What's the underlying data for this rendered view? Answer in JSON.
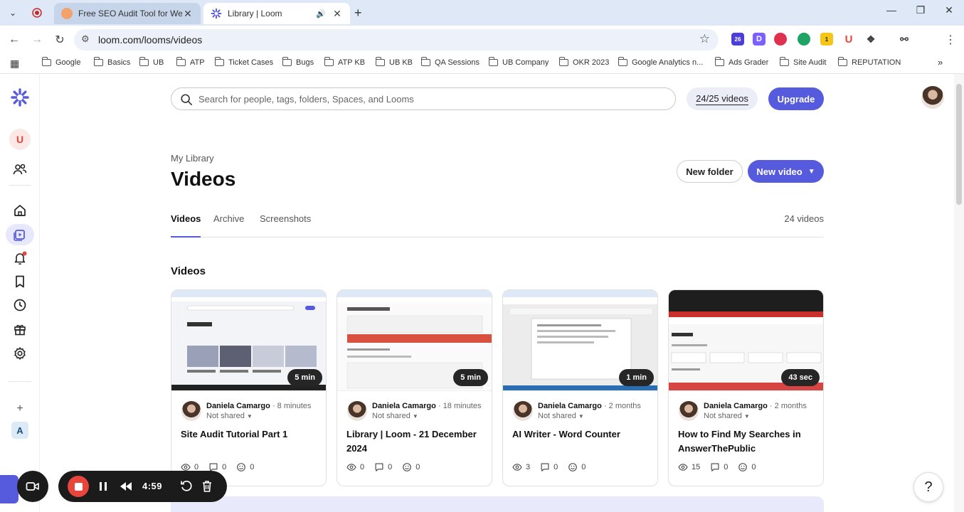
{
  "browser": {
    "tabs": [
      {
        "title": "Free SEO Audit Tool for Websites",
        "active": false
      },
      {
        "title": "Library | Loom",
        "active": true
      }
    ],
    "url": "loom.com/looms/videos",
    "extension_badges": {
      "count": "26",
      "one": "1"
    },
    "bookmarks": [
      "Google",
      "Basics",
      "UB",
      "ATP",
      "Ticket Cases",
      "Bugs",
      "ATP KB",
      "UB KB",
      "QA Sessions",
      "UB Company",
      "OKR 2023",
      "Google Analytics n...",
      "Ads Grader",
      "Site Audit",
      "REPUTATION"
    ]
  },
  "loom": {
    "workspace_initial": "U",
    "search_placeholder": "Search for people, tags, folders, Spaces, and Looms",
    "quota": "24/25 videos",
    "upgrade_label": "Upgrade",
    "breadcrumb": "My Library",
    "title": "Videos",
    "new_folder_label": "New folder",
    "new_video_label": "New video",
    "tabs": [
      "Videos",
      "Archive",
      "Screenshots"
    ],
    "video_count": "24 videos",
    "section_title": "Videos",
    "videos": [
      {
        "duration": "5 min",
        "author": "Daniela Camargo",
        "ago": "8 minutes",
        "shared": "Not shared",
        "title": "Site Audit Tutorial Part 1",
        "views": "0",
        "comments": "0",
        "reactions": "0"
      },
      {
        "duration": "5 min",
        "author": "Daniela Camargo",
        "ago": "18 minutes",
        "shared": "Not shared",
        "title": "Library | Loom - 21 December 2024",
        "views": "0",
        "comments": "0",
        "reactions": "0"
      },
      {
        "duration": "1 min",
        "author": "Daniela Camargo",
        "ago": "2 months",
        "shared": "Not shared",
        "title": "AI Writer - Word Counter",
        "views": "3",
        "comments": "0",
        "reactions": "0"
      },
      {
        "duration": "43 sec",
        "author": "Daniela Camargo",
        "ago": "2 months",
        "shared": "Not shared",
        "title": "How to Find My Searches in AnswerThePublic",
        "views": "15",
        "comments": "0",
        "reactions": "0"
      }
    ],
    "recorder_time": "4:59",
    "help_label": "?"
  },
  "colors": {
    "accent": "#565add",
    "record": "#e8453c",
    "chrome": "#dfe8f6"
  }
}
